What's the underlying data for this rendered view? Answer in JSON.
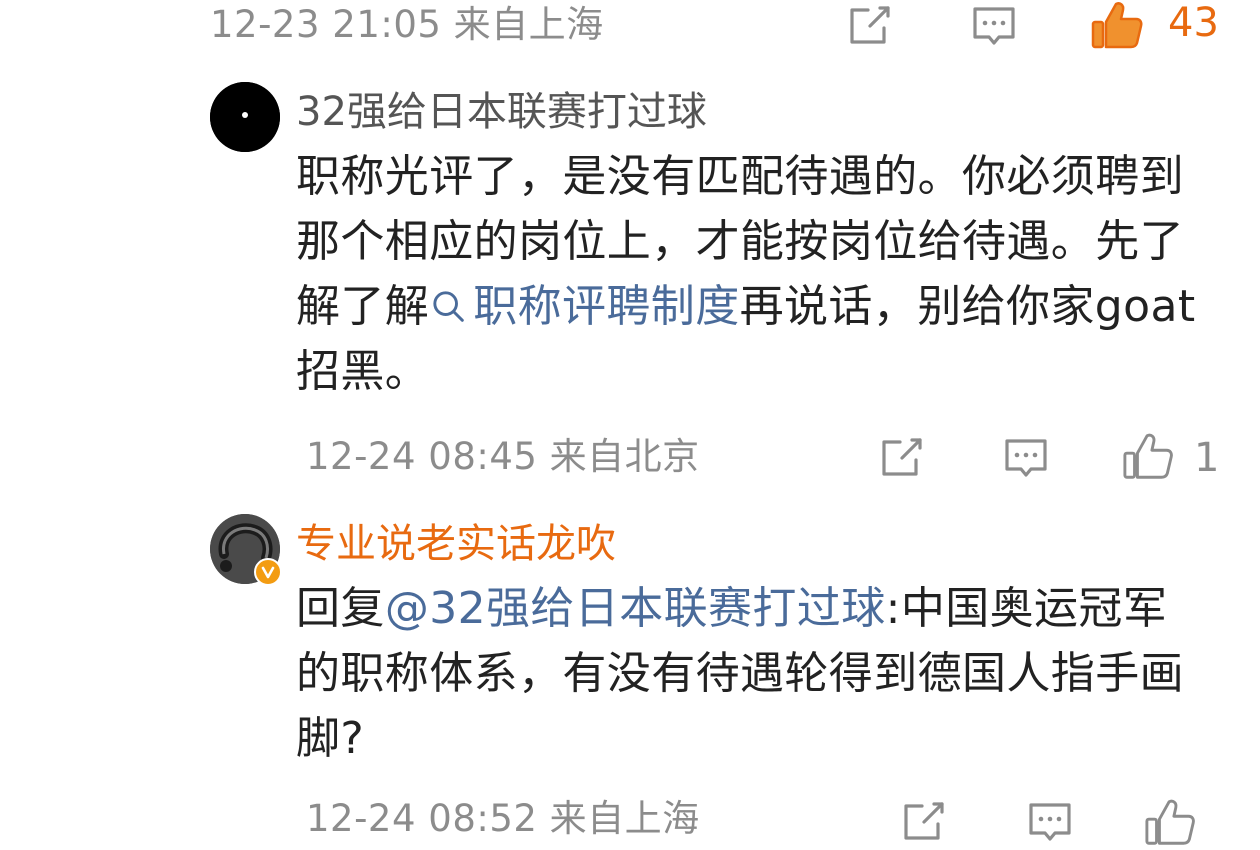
{
  "comment_top": {
    "time": "12-23 21:05",
    "location": "来自上海",
    "likes": "43",
    "liked": true
  },
  "reply1": {
    "username": "32强给日本联赛打过球",
    "text_before": "职称光评了，是没有匹配待遇的。你必须聘到那个相应的岗位上，才能按岗位给待遇。先了解了解",
    "search_link": "职称评聘制度",
    "text_after": "再说话，别给你家goat招黑。",
    "time": "12-24 08:45",
    "location": "来自北京",
    "likes": "1"
  },
  "reply2": {
    "username": "专业说老实话龙吹",
    "verified": true,
    "reply_prefix": "回复",
    "mention": "@32强给日本联赛打过球",
    "text": ":中国奥运冠军的职称体系，有没有待遇轮得到德国人指手画脚?",
    "time": "12-24 08:52",
    "location": "来自上海"
  },
  "icons": {
    "share": "share-icon",
    "comment": "comment-icon",
    "like": "thumbs-up-icon",
    "search": "search-icon",
    "verified": "verified-badge-icon"
  },
  "colors": {
    "accent_orange": "#e86a10",
    "link_blue": "#4a6b9a",
    "meta_gray": "#8c8c8c",
    "text": "#222222"
  }
}
